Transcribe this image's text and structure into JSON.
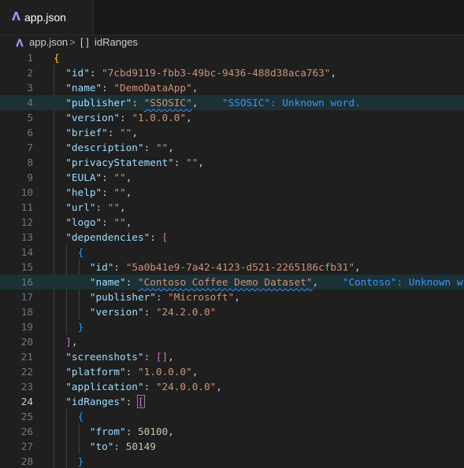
{
  "tab": {
    "label": "app.json"
  },
  "breadcrumb": {
    "file": "app.json",
    "separator": ">",
    "symbol_icon": "[ ]",
    "symbol": "idRanges"
  },
  "diagnostics": {
    "publisher": "\"SSOSIC\": Unknown word.",
    "contoso": "\"Contoso\": Unknown w"
  },
  "lines": [
    {
      "n": "1"
    },
    {
      "n": "2"
    },
    {
      "n": "3"
    },
    {
      "n": "4"
    },
    {
      "n": "5"
    },
    {
      "n": "6"
    },
    {
      "n": "7"
    },
    {
      "n": "8"
    },
    {
      "n": "9"
    },
    {
      "n": "10"
    },
    {
      "n": "11"
    },
    {
      "n": "12"
    },
    {
      "n": "13"
    },
    {
      "n": "14"
    },
    {
      "n": "15"
    },
    {
      "n": "16"
    },
    {
      "n": "17"
    },
    {
      "n": "18"
    },
    {
      "n": "19"
    },
    {
      "n": "20"
    },
    {
      "n": "21"
    },
    {
      "n": "22"
    },
    {
      "n": "23"
    },
    {
      "n": "24"
    },
    {
      "n": "25"
    },
    {
      "n": "26"
    },
    {
      "n": "27"
    },
    {
      "n": "28"
    }
  ],
  "json": {
    "id": "\"7cbd9119-fbb3-49bc-9436-488d38aca763\"",
    "name": "\"DemoDataApp\"",
    "publisher": "\"SSOSIC\"",
    "version": "\"1.0.0.0\"",
    "brief": "\"\"",
    "description": "\"\"",
    "privacyStatement": "\"\"",
    "EULA": "\"\"",
    "help": "\"\"",
    "url": "\"\"",
    "logo": "\"\"",
    "dep_id": "\"5a0b41e9-7a42-4123-d521-2265186cfb31\"",
    "dep_name": "\"Contoso Coffee Demo Dataset\"",
    "dep_publisher": "\"Microsoft\"",
    "dep_version": "\"24.2.0.0\"",
    "platform": "\"1.0.0.0\"",
    "application": "\"24.0.0.0\"",
    "from": "50100",
    "to": "50149"
  },
  "keys": {
    "id": "\"id\"",
    "name": "\"name\"",
    "publisher": "\"publisher\"",
    "version": "\"version\"",
    "brief": "\"brief\"",
    "description": "\"description\"",
    "privacyStatement": "\"privacyStatement\"",
    "EULA": "\"EULA\"",
    "help": "\"help\"",
    "url": "\"url\"",
    "logo": "\"logo\"",
    "dependencies": "\"dependencies\"",
    "screenshots": "\"screenshots\"",
    "platform": "\"platform\"",
    "application": "\"application\"",
    "idRanges": "\"idRanges\"",
    "from": "\"from\"",
    "to": "\"to\""
  }
}
